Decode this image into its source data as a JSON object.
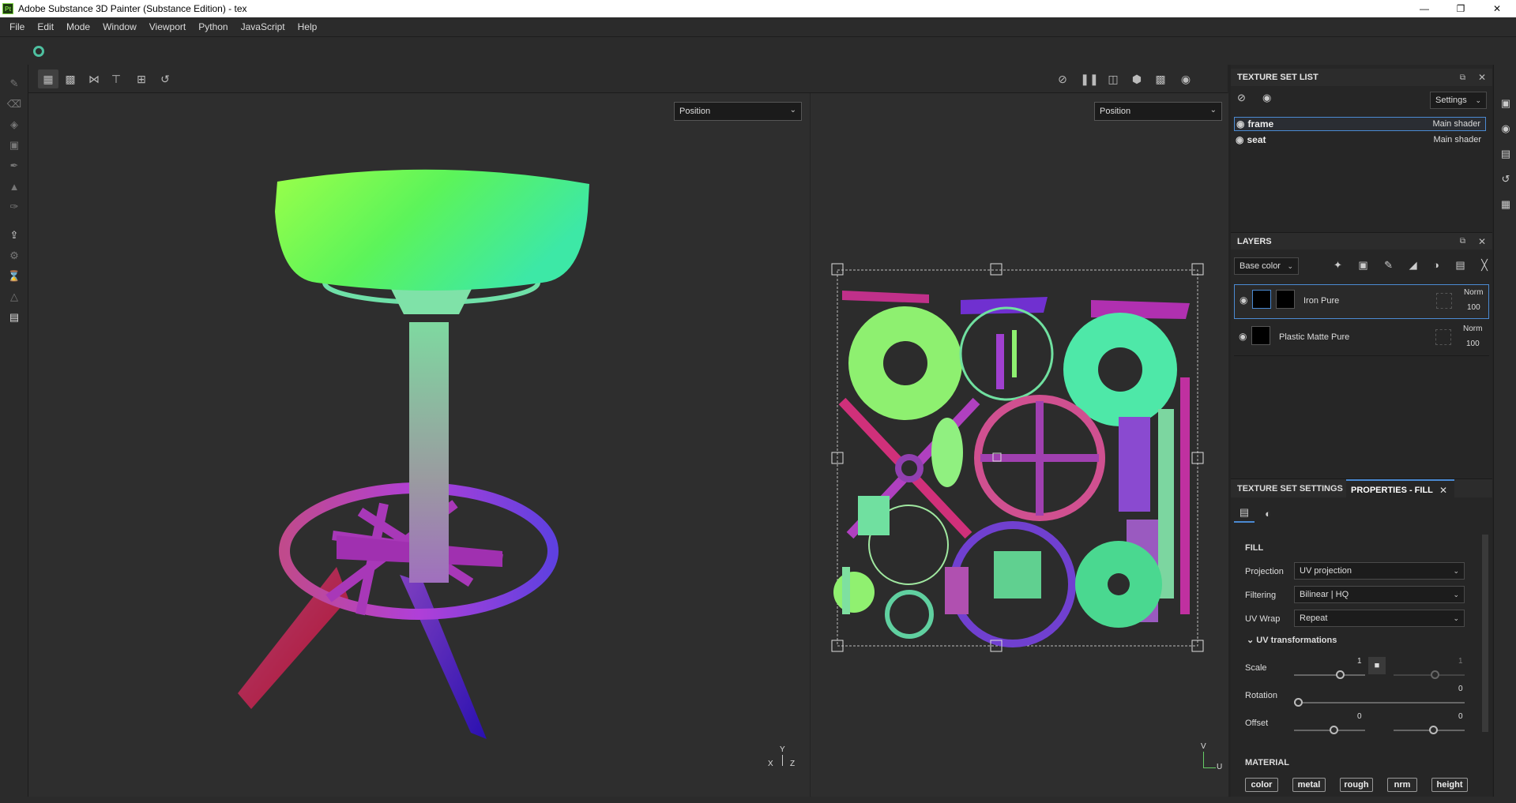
{
  "app": {
    "title": "Adobe Substance 3D Painter (Substance Edition) - tex",
    "logo": "Pt"
  },
  "menu": [
    "File",
    "Edit",
    "Mode",
    "Window",
    "Viewport",
    "Python",
    "JavaScript",
    "Help"
  ],
  "viewport3d": {
    "mode": "Position",
    "axis_y": "Y",
    "axis_x": "X",
    "axis_z": "Z"
  },
  "viewport2d": {
    "mode": "Position",
    "axis_v": "V",
    "axis_u": "U"
  },
  "texture_set_list": {
    "title": "TEXTURE SET LIST",
    "settings_label": "Settings",
    "items": [
      {
        "name": "frame",
        "shader": "Main shader"
      },
      {
        "name": "seat",
        "shader": "Main shader"
      }
    ]
  },
  "layers": {
    "title": "LAYERS",
    "channel": "Base color",
    "items": [
      {
        "name": "Iron Pure",
        "blend": "Norm",
        "opacity": "100"
      },
      {
        "name": "Plastic Matte Pure",
        "blend": "Norm",
        "opacity": "100"
      }
    ]
  },
  "properties": {
    "tab_settings": "TEXTURE SET SETTINGS",
    "tab_fill": "PROPERTIES - FILL",
    "fill_header": "FILL",
    "projection_label": "Projection",
    "projection_value": "UV projection",
    "filtering_label": "Filtering",
    "filtering_value": "Bilinear | HQ",
    "uvwrap_label": "UV Wrap",
    "uvwrap_value": "Repeat",
    "uvtrans_label": "UV transformations",
    "scale_label": "Scale",
    "scale_value": "1",
    "scale_value2": "1",
    "rotation_label": "Rotation",
    "rotation_value": "0",
    "offset_label": "Offset",
    "offset_value1": "0",
    "offset_value2": "0",
    "material_header": "MATERIAL",
    "material_buttons": [
      "color",
      "metal",
      "rough",
      "nrm",
      "height"
    ]
  },
  "colors": {
    "accent": "#4b8ad2",
    "panel_bg": "#262626",
    "viewport_bg": "#2e2e2e"
  }
}
